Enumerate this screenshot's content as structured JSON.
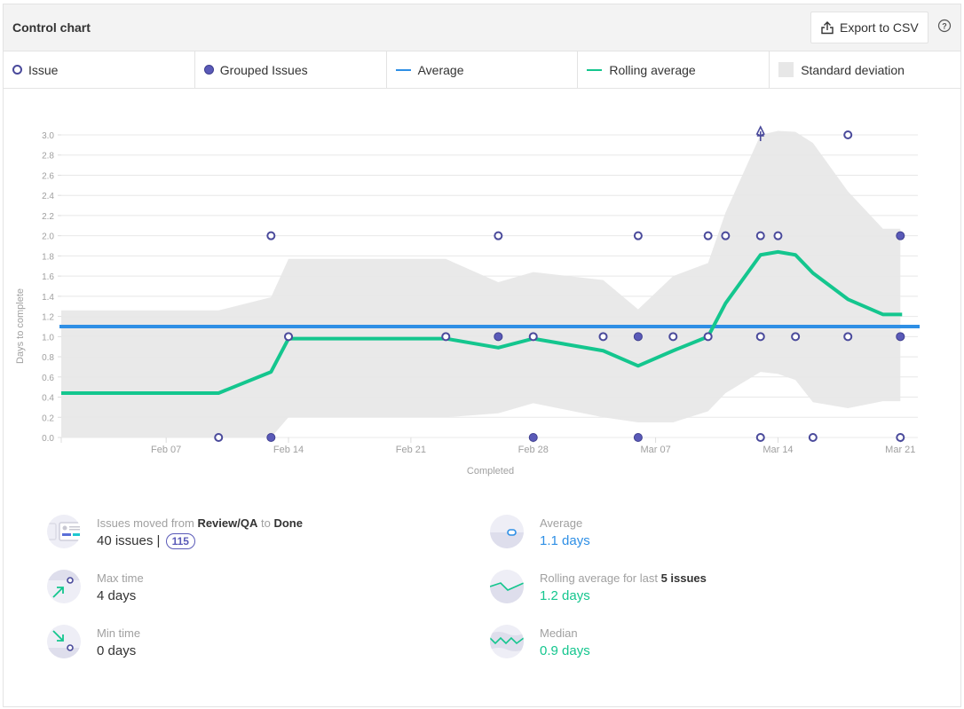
{
  "header": {
    "title": "Control chart",
    "export_label": "Export to CSV",
    "help_icon": "question-circle-icon"
  },
  "legend": [
    {
      "label": "Issue",
      "swatch": "issue"
    },
    {
      "label": "Grouped Issues",
      "swatch": "grouped"
    },
    {
      "label": "Average",
      "swatch": "avg"
    },
    {
      "label": "Rolling average",
      "swatch": "roll"
    },
    {
      "label": "Standard deviation",
      "swatch": "std"
    }
  ],
  "colors": {
    "issue": "#4a4a9b",
    "grouped": "#5a5ab8",
    "average": "#2e8fe5",
    "rolling": "#14c68e",
    "std": "#e9e9e9",
    "grid": "#e8e8e8",
    "axis_text": "#a0a0a0"
  },
  "chart_data": {
    "type": "scatter",
    "title": "",
    "xlabel": "Completed",
    "ylabel": "Days to complete",
    "x_unit": "days since Feb 01",
    "xlim": [
      0,
      49
    ],
    "ylim": [
      0,
      3.0
    ],
    "yticks": [
      0.0,
      0.2,
      0.4,
      0.6,
      0.8,
      1.0,
      1.2,
      1.4,
      1.6,
      1.8,
      2.0,
      2.2,
      2.4,
      2.6,
      2.8,
      3.0
    ],
    "xticks": [
      {
        "x": 6,
        "label": "Feb 07"
      },
      {
        "x": 13,
        "label": "Feb 14"
      },
      {
        "x": 20,
        "label": "Feb 21"
      },
      {
        "x": 27,
        "label": "Feb 28"
      },
      {
        "x": 34,
        "label": "Mar 07"
      },
      {
        "x": 41,
        "label": "Mar 14"
      },
      {
        "x": 48,
        "label": "Mar 21"
      }
    ],
    "grid": true,
    "average": 1.1,
    "issues": [
      {
        "x": 9,
        "y": 0.0
      },
      {
        "x": 12,
        "y": 2.0
      },
      {
        "x": 13,
        "y": 1.0
      },
      {
        "x": 22,
        "y": 1.0
      },
      {
        "x": 25,
        "y": 2.0
      },
      {
        "x": 27,
        "y": 1.0
      },
      {
        "x": 31,
        "y": 1.0
      },
      {
        "x": 33,
        "y": 2.0
      },
      {
        "x": 35,
        "y": 1.0
      },
      {
        "x": 37,
        "y": 2.0
      },
      {
        "x": 37,
        "y": 1.0
      },
      {
        "x": 38,
        "y": 2.0
      },
      {
        "x": 40,
        "y": 2.0
      },
      {
        "x": 40,
        "y": 1.0
      },
      {
        "x": 40,
        "y": 0.0
      },
      {
        "x": 41,
        "y": 2.0
      },
      {
        "x": 42,
        "y": 1.0
      },
      {
        "x": 43,
        "y": 0.0
      },
      {
        "x": 45,
        "y": 3.0
      },
      {
        "x": 45,
        "y": 1.0
      },
      {
        "x": 48,
        "y": 0.0
      }
    ],
    "grouped_issues": [
      {
        "x": 12,
        "y": 0.0
      },
      {
        "x": 25,
        "y": 1.0
      },
      {
        "x": 27,
        "y": 0.0
      },
      {
        "x": 33,
        "y": 1.0
      },
      {
        "x": 33,
        "y": 0.0
      },
      {
        "x": 48,
        "y": 2.0
      },
      {
        "x": 48,
        "y": 1.0
      }
    ],
    "outliers": [
      {
        "x": 40,
        "y": 3.0,
        "marker": "up-arrow",
        "note": "above chart range"
      }
    ],
    "rolling_average": [
      [
        0,
        0.44
      ],
      [
        9,
        0.44
      ],
      [
        12,
        0.65
      ],
      [
        13,
        0.98
      ],
      [
        22,
        0.98
      ],
      [
        25,
        0.89
      ],
      [
        27,
        0.98
      ],
      [
        31,
        0.86
      ],
      [
        33,
        0.71
      ],
      [
        35,
        0.86
      ],
      [
        37,
        1.0
      ],
      [
        38,
        1.33
      ],
      [
        40,
        1.81
      ],
      [
        41,
        1.84
      ],
      [
        42,
        1.81
      ],
      [
        43,
        1.63
      ],
      [
        45,
        1.37
      ],
      [
        47,
        1.22
      ],
      [
        48.1,
        1.22
      ]
    ],
    "std_band": {
      "upper": [
        [
          0,
          1.26
        ],
        [
          9,
          1.26
        ],
        [
          12,
          1.39
        ],
        [
          13,
          1.77
        ],
        [
          22,
          1.77
        ],
        [
          25,
          1.54
        ],
        [
          27,
          1.64
        ],
        [
          31,
          1.56
        ],
        [
          33,
          1.27
        ],
        [
          35,
          1.6
        ],
        [
          37,
          1.73
        ],
        [
          38,
          2.23
        ],
        [
          40,
          3.0
        ],
        [
          41,
          3.04
        ],
        [
          42,
          3.03
        ],
        [
          43,
          2.92
        ],
        [
          45,
          2.44
        ],
        [
          47,
          2.07
        ],
        [
          48,
          2.07
        ]
      ],
      "lower": [
        [
          0,
          0.0
        ],
        [
          12,
          0.0
        ],
        [
          13,
          0.2
        ],
        [
          22,
          0.2
        ],
        [
          25,
          0.24
        ],
        [
          27,
          0.34
        ],
        [
          31,
          0.2
        ],
        [
          33,
          0.15
        ],
        [
          35,
          0.15
        ],
        [
          37,
          0.26
        ],
        [
          38,
          0.44
        ],
        [
          40,
          0.65
        ],
        [
          41,
          0.63
        ],
        [
          42,
          0.57
        ],
        [
          43,
          0.35
        ],
        [
          45,
          0.29
        ],
        [
          47,
          0.36
        ],
        [
          48,
          0.36
        ]
      ]
    }
  },
  "stats": {
    "moved": {
      "label_pre": "Issues moved from ",
      "from": "Review/QA",
      "label_mid": " to ",
      "to": "Done",
      "value": "40 issues |",
      "badge": "115"
    },
    "max": {
      "label": "Max time",
      "value": "4 days"
    },
    "min": {
      "label": "Min time",
      "value": "0 days"
    },
    "average": {
      "label": "Average",
      "value": "1.1 days"
    },
    "rolling": {
      "label_pre": "Rolling average for last ",
      "count": "5 issues",
      "value": "1.2 days"
    },
    "median": {
      "label": "Median",
      "value": "0.9 days"
    }
  }
}
